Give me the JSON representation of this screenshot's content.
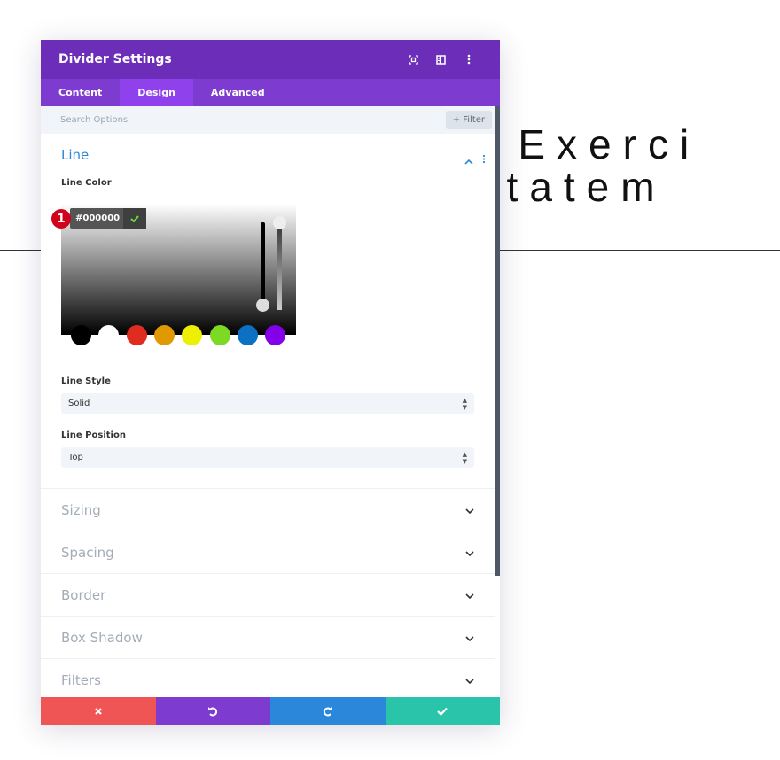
{
  "background": {
    "line1": "d Exerci",
    "line2": "ritatem"
  },
  "modal": {
    "title": "Divider Settings",
    "header_icons": [
      "focus-icon",
      "layout-icon",
      "more-icon"
    ],
    "tabs": [
      {
        "label": "Content"
      },
      {
        "label": "Design",
        "active": true
      },
      {
        "label": "Advanced"
      }
    ],
    "search": {
      "placeholder": "Search Options",
      "filter_label": "Filter"
    },
    "line_section": {
      "title": "Line",
      "line_color_label": "Line Color",
      "color_value": "#000000",
      "badge": "1",
      "swatches": [
        "#000000",
        "#ffffff",
        "#e02b20",
        "#e09900",
        "#edf000",
        "#7cda24",
        "#0c71c3",
        "#8300e9"
      ],
      "line_style_label": "Line Style",
      "line_style_value": "Solid",
      "line_position_label": "Line Position",
      "line_position_value": "Top"
    },
    "sections": [
      "Sizing",
      "Spacing",
      "Border",
      "Box Shadow",
      "Filters"
    ],
    "footer": {
      "colors": [
        "#ef5555",
        "#7e3bd0",
        "#2b87da",
        "#29c4a9"
      ]
    }
  }
}
